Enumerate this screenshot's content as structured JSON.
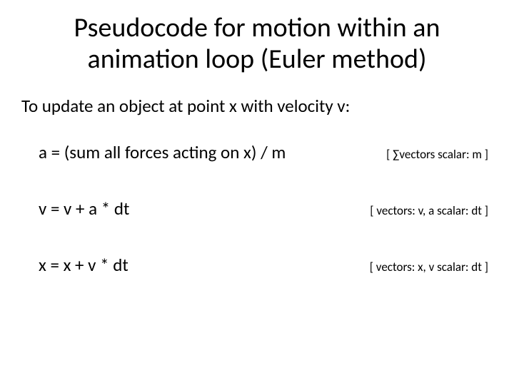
{
  "title": "Pseudocode for motion within an animation loop (Euler method)",
  "intro": "To update an object at point x with velocity v:",
  "lines": [
    {
      "code": "a = (sum all forces acting on x) / m",
      "note": "[  ∑vectors   scalar: m   ]"
    },
    {
      "code": "v = v + a * dt",
      "note": "[ vectors: v, a    scalar: dt ]"
    },
    {
      "code": "x = x + v * dt",
      "note": "[ vectors: x, v   scalar: dt ]"
    }
  ]
}
